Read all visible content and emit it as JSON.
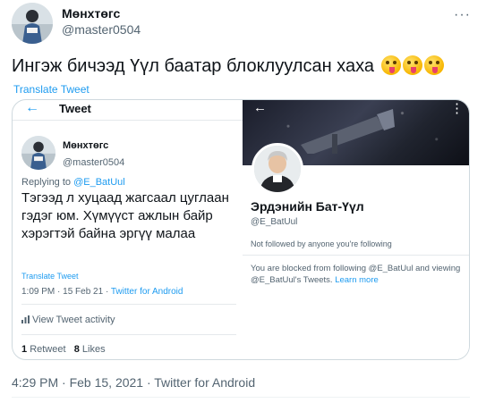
{
  "tweet": {
    "author_name": "Мөнхтөгс",
    "author_handle": "@master0504",
    "text": "Ингэж бичээд Үүл баатар блоклуулсан хаха",
    "emoji_count": 3,
    "emoji_icon": "squinting-face-with-tongue-icon",
    "translate_label": "Translate Tweet",
    "more_label": "···",
    "timestamp": "4:29 PM · Feb 15, 2021 · Twitter for Android"
  },
  "embedded_left": {
    "back_icon": "←",
    "title": "Tweet",
    "author_name": "Мөнхтөгс",
    "author_handle": "@master0504",
    "replying_prefix": "Replying to ",
    "replying_handle": "@E_BatUul",
    "text": "Тэгээд л хуцаад жагсаал цуглаан гэдэг юм. Хүмүүст ажлын байр хэрэгтэй байна эргүү малаа",
    "translate_label": "Translate Tweet",
    "time": "1:09 PM · 15 Feb 21 · ",
    "source": "Twitter for Android",
    "activity_label": "View Tweet activity",
    "activity_icon": "bar-chart-icon",
    "retweets_count": "1",
    "retweets_label": "Retweet",
    "likes_count": "8",
    "likes_label": "Likes"
  },
  "embedded_right": {
    "back_icon": "←",
    "more_icon": "⋮",
    "name": "Эрдэнийн Бат-Үүл",
    "handle": "@E_BatUul",
    "follow_status": "Not followed by anyone you're following",
    "blocked_text": "You are blocked from following @E_BatUul and viewing @E_BatUul's Tweets. ",
    "learn_more": "Learn more"
  }
}
